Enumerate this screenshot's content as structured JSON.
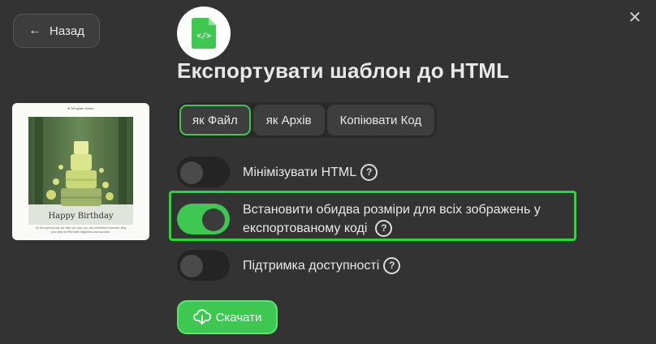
{
  "header": {
    "back_label": "Назад",
    "title": "Експортувати шаблон до HTML"
  },
  "preview": {
    "brand": "♥ Template Name",
    "heading": "Happy Birthday",
    "body": "On this special day, we wish you love, joy, and cherished moments. May your year be filled with happiness and success."
  },
  "export_modes": {
    "items": [
      {
        "label": "як Файл",
        "active": true
      },
      {
        "label": "як Архів",
        "active": false
      },
      {
        "label": "Копіювати Код",
        "active": false
      }
    ]
  },
  "options": {
    "minify": {
      "label": "Мінімізувати HTML",
      "enabled": false
    },
    "image_sizes": {
      "label_line1": "Встановити обидва розміри для всіх зображень у",
      "label_line2": "експортованому коді",
      "enabled": true
    },
    "accessibility": {
      "label": "Підтримка доступності",
      "enabled": false
    }
  },
  "actions": {
    "download_label": "Скачати"
  },
  "colors": {
    "accent": "#3ec852",
    "highlight": "#26d93a",
    "background": "#333333"
  },
  "icons": {
    "back": "arrow-left-icon",
    "close": "close-icon",
    "file": "code-file-icon",
    "help": "question-circle-icon",
    "download": "cloud-download-icon"
  }
}
